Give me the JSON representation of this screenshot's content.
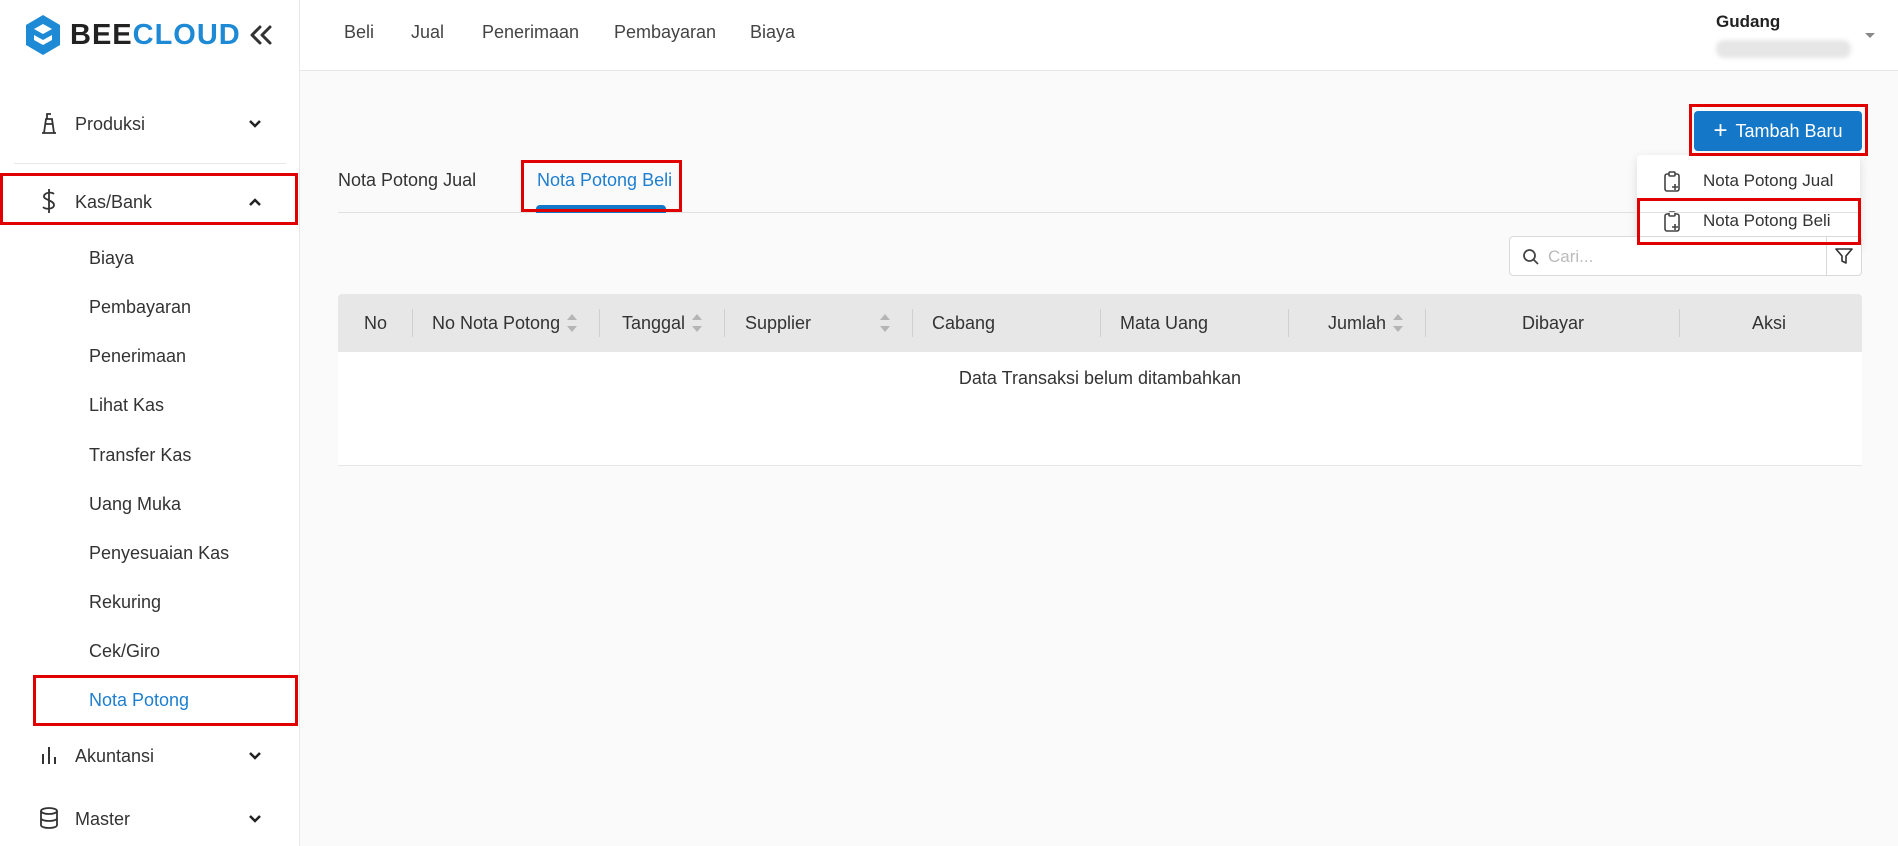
{
  "brand": {
    "name_part1": "BEE",
    "name_part2": "CLOUD"
  },
  "colors": {
    "accent": "#1577c8",
    "brand": "#1e8ad6",
    "highlight": "#e00000",
    "active_link": "#1e7fd0"
  },
  "sidebar": {
    "groups": [
      {
        "label": "Produksi",
        "icon": "production-icon",
        "expanded": false
      },
      {
        "label": "Kas/Bank",
        "icon": "dollar-icon",
        "expanded": true
      },
      {
        "label": "Akuntansi",
        "icon": "bar-chart-icon",
        "expanded": false
      },
      {
        "label": "Master",
        "icon": "database-icon",
        "expanded": false
      }
    ],
    "kas_bank_items": [
      {
        "label": "Biaya"
      },
      {
        "label": "Pembayaran"
      },
      {
        "label": "Penerimaan"
      },
      {
        "label": "Lihat Kas"
      },
      {
        "label": "Transfer Kas"
      },
      {
        "label": "Uang Muka"
      },
      {
        "label": "Penyesuaian Kas"
      },
      {
        "label": "Rekuring"
      },
      {
        "label": "Cek/Giro"
      },
      {
        "label": "Nota Potong",
        "active": true
      }
    ]
  },
  "topnav": {
    "items": [
      {
        "label": "Beli"
      },
      {
        "label": "Jual"
      },
      {
        "label": "Penerimaan"
      },
      {
        "label": "Pembayaran"
      },
      {
        "label": "Biaya"
      }
    ],
    "user": {
      "name": "Gudang"
    }
  },
  "main": {
    "add_button": "Tambah Baru",
    "dropdown": [
      {
        "label": "Nota Potong Jual",
        "icon": "clipboard-plus-icon"
      },
      {
        "label": "Nota Potong Beli",
        "icon": "clipboard-plus-icon"
      }
    ],
    "tabs": [
      {
        "label": "Nota Potong Jual",
        "active": false
      },
      {
        "label": "Nota Potong Beli",
        "active": true
      }
    ],
    "search": {
      "placeholder": "Cari..."
    },
    "table": {
      "columns": [
        {
          "label": "No",
          "sortable": false
        },
        {
          "label": "No Nota Potong",
          "sortable": true
        },
        {
          "label": "Tanggal",
          "sortable": true
        },
        {
          "label": "Supplier",
          "sortable": true
        },
        {
          "label": "Cabang",
          "sortable": false
        },
        {
          "label": "Mata Uang",
          "sortable": false
        },
        {
          "label": "Jumlah",
          "sortable": true
        },
        {
          "label": "Dibayar",
          "sortable": false
        },
        {
          "label": "Aksi",
          "sortable": false
        }
      ],
      "empty_message": "Data Transaksi belum ditambahkan"
    }
  }
}
